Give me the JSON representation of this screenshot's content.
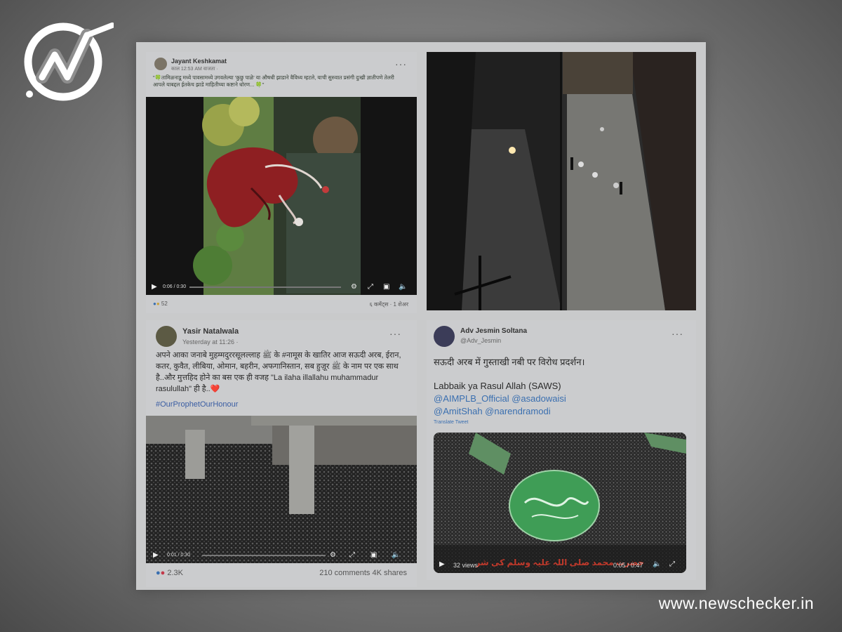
{
  "brand": {
    "site": "www.newschecker.in",
    "logo_icon": "newschecker-check-logo-icon"
  },
  "post1": {
    "author": "Jayant Keshkamat",
    "meta": "काल 12:53 AM वाजता ·",
    "caption": "\"🍀तामिळनाडू मध्ये पावसामध्ये उगवलेल्या 'कुछु पाळे' या औषधी झाडाने वैविध्य म्हटले, याची सुरुवात प्रसंगी दुःखी ज्ञातीपणे तेलरी आपले याबद्दल ईतकेच झाडे माहितीच्या कष्टाने धोरण... 🍀\"",
    "video_time": "0:06 / 0:30",
    "reactions": "52",
    "stats": "६ कमेंट्स · 1 शेअर"
  },
  "post2": {
    "author": "Yasir Natalwala",
    "meta": "Yesterday at 11:26 ·",
    "text": "अपने आका जनाबे मुहम्मदुररसूलल्लाह ﷺ के #नामूस के खातिर आज सऊदी अरब, ईरान, कतर, कुवैत, लीबिया, ओमान, बहरीन, अफगानिस्तान, सब हुज़ूर ﷺ के नाम पर एक साथ है..और मुत्तहिद होने का बस एक ही वजह \"La ilaha illallahu muhammadur rasulullah\" ही है..❤️",
    "hashtag": "#OurProphetOurHonour",
    "video_time": "0:01 / 0:30",
    "reactions": "2.3K",
    "stats": "210 comments  4K shares"
  },
  "tweet": {
    "name": "Adv Jesmin Soltana",
    "handle": "@Adv_Jesmin",
    "line1": "सऊदी अरब में गुस्ताखी नबी पर विरोध प्रदर्शन।",
    "line2": "Labbaik ya Rasul Allah (SAWS)",
    "mentions1": "@AIMPLB_Official @asadowaisi",
    "mentions2": "@AmitShah @narendramodi",
    "translate": "Translate Tweet",
    "views": "32 views",
    "video_time": "0:05 / 0:47",
    "overlay_text": "حضرت محمد صلی اللہ علیہ وسلم کی شرافت کے سامنے"
  }
}
